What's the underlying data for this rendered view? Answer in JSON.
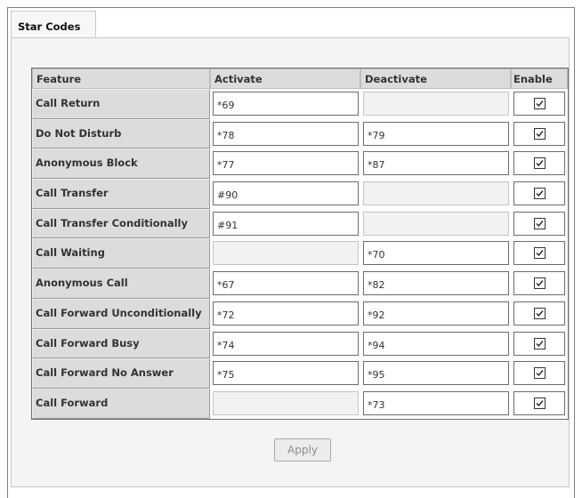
{
  "tab_label": "Star Codes",
  "columns": {
    "feature": "Feature",
    "activate": "Activate",
    "deactivate": "Deactivate",
    "enable": "Enable"
  },
  "rows": [
    {
      "feature": "Call Return",
      "activate": "*69",
      "activate_enabled": true,
      "deactivate": "",
      "deactivate_enabled": false,
      "enable": true
    },
    {
      "feature": "Do Not Disturb",
      "activate": "*78",
      "activate_enabled": true,
      "deactivate": "*79",
      "deactivate_enabled": true,
      "enable": true
    },
    {
      "feature": "Anonymous Block",
      "activate": "*77",
      "activate_enabled": true,
      "deactivate": "*87",
      "deactivate_enabled": true,
      "enable": true
    },
    {
      "feature": "Call Transfer",
      "activate": "#90",
      "activate_enabled": true,
      "deactivate": "",
      "deactivate_enabled": false,
      "enable": true
    },
    {
      "feature": "Call Transfer Conditionally",
      "activate": "#91",
      "activate_enabled": true,
      "deactivate": "",
      "deactivate_enabled": false,
      "enable": true
    },
    {
      "feature": "Call Waiting",
      "activate": "",
      "activate_enabled": false,
      "deactivate": "*70",
      "deactivate_enabled": true,
      "enable": true
    },
    {
      "feature": "Anonymous Call",
      "activate": "*67",
      "activate_enabled": true,
      "deactivate": "*82",
      "deactivate_enabled": true,
      "enable": true
    },
    {
      "feature": "Call Forward Unconditionally",
      "activate": "*72",
      "activate_enabled": true,
      "deactivate": "*92",
      "deactivate_enabled": true,
      "enable": true
    },
    {
      "feature": "Call Forward Busy",
      "activate": "*74",
      "activate_enabled": true,
      "deactivate": "*94",
      "deactivate_enabled": true,
      "enable": true
    },
    {
      "feature": "Call Forward No Answer",
      "activate": "*75",
      "activate_enabled": true,
      "deactivate": "*95",
      "deactivate_enabled": true,
      "enable": true
    },
    {
      "feature": "Call Forward",
      "activate": "",
      "activate_enabled": false,
      "deactivate": "*73",
      "deactivate_enabled": true,
      "enable": true
    }
  ],
  "apply_label": "Apply",
  "icons": {
    "enable_checkbox": "checkbox-checked-icon"
  },
  "colors": {
    "header_bg": "#dcdcdc",
    "panel_bg": "#f4f4f4",
    "disabled_field_bg": "#f2f2f2"
  }
}
